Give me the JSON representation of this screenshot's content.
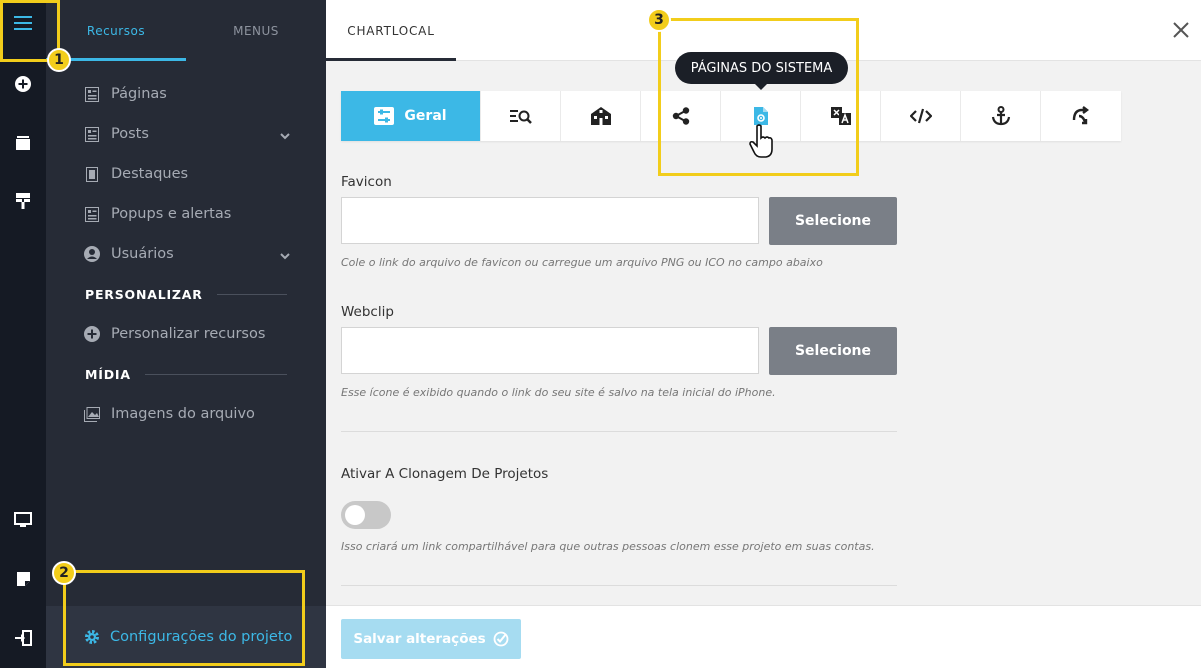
{
  "sidebar_tabs": {
    "resources": "Recursos",
    "menus": "MENUS"
  },
  "nav": {
    "pages": "Páginas",
    "posts": "Posts",
    "highlights": "Destaques",
    "popups": "Popups e alertas",
    "users": "Usuários",
    "customize_section": "PERSONALIZAR",
    "customize_resources": "Personalizar recursos",
    "media_section": "MÍDIA",
    "file_images": "Imagens do arquivo",
    "project_settings": "Configurações do projeto"
  },
  "main": {
    "tab": "CHARTLOCAL",
    "tooltip": "PÁGINAS DO SISTEMA",
    "general_tab": "Geral",
    "favicon_label": "Favicon",
    "favicon_hint": "Cole o link do arquivo de favicon ou carregue um arquivo PNG ou ICO no campo abaixo",
    "select_label": "Selecione",
    "webclip_label": "Webclip",
    "webclip_hint": "Esse ícone é exibido quando o link do seu site é salvo na tela inicial do iPhone.",
    "clone_label": "Ativar A Clonagem De Projetos",
    "clone_hint": "Isso criará um link compartilhável para que outras pessoas clonem esse projeto em suas contas.",
    "clone_enabled": false,
    "save_label": "Salvar alterações"
  },
  "annotations": {
    "one": "1",
    "two": "2",
    "three": "3"
  },
  "colors": {
    "accent": "#3cb8e6",
    "highlight": "#f2cd1b",
    "sidebar": "#262b36",
    "rail": "#151a24"
  },
  "icons": {
    "iconbar": [
      "sliders-icon",
      "search-list-icon",
      "building-icon",
      "share-icon",
      "system-page-icon",
      "translate-icon",
      "code-icon",
      "anchor-icon",
      "redirect-icon"
    ]
  }
}
